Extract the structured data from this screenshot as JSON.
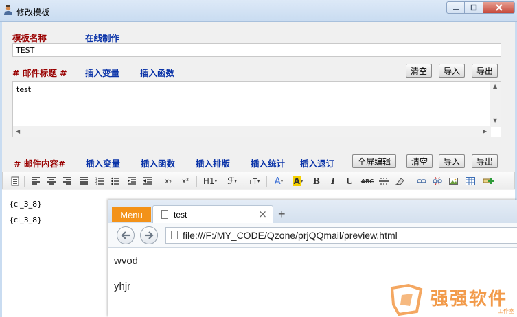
{
  "window": {
    "title": "修改模板"
  },
  "template_name": {
    "label": "模板名称",
    "online_link": "在线制作",
    "value": "TEST"
  },
  "subject": {
    "label": "# 邮件标题 #",
    "insert_variable": "插入变量",
    "insert_function": "插入函数",
    "clear": "清空",
    "import": "导入",
    "export": "导出",
    "value": "test"
  },
  "content": {
    "label": "# 邮件内容#",
    "insert_variable": "插入变量",
    "insert_function": "插入函数",
    "insert_layout": "插入排版",
    "insert_stats": "插入统计",
    "insert_unsubscribe": "插入退订",
    "fullscreen": "全屏编辑",
    "clear": "清空",
    "import": "导入",
    "export": "导出"
  },
  "toolbar": {
    "heading": "H1",
    "font": "ℱ",
    "font_size": "тT",
    "font_color": "A",
    "highlight": "A",
    "bold": "B",
    "italic": "I",
    "underline": "U",
    "strike": "ABC",
    "subscript": "x₂",
    "superscript": "x²",
    "colors": {
      "font_color": "#3b6fd6",
      "highlight": "#f5d000"
    }
  },
  "editor": {
    "lines": [
      "{cl_3_8}",
      "{cl_3_8}"
    ]
  },
  "browser": {
    "menu": "Menu",
    "tab_title": "test",
    "tab_close": "×",
    "new_tab": "+",
    "url": "file:///F:/MY_CODE/Qzone/prjQQmail/preview.html",
    "page_lines": [
      "wvod",
      "yhjr"
    ],
    "accent": "#f39219"
  },
  "watermark": {
    "text": "强强软件",
    "sub": "工作室",
    "color": "#f08a2c"
  }
}
